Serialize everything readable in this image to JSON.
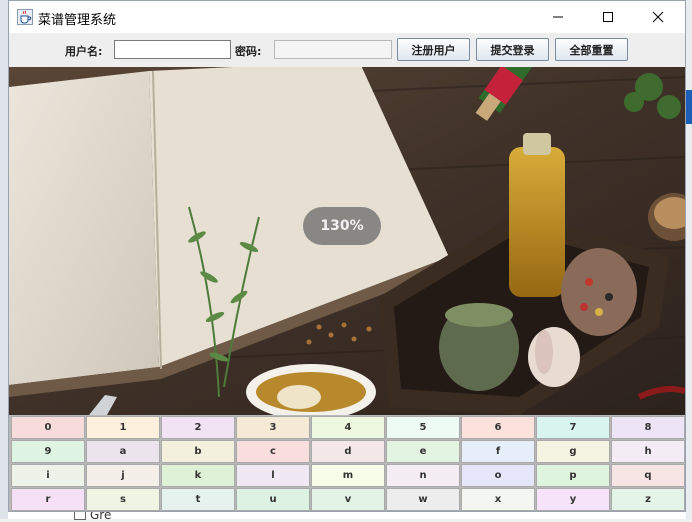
{
  "window": {
    "title": "菜谱管理系统"
  },
  "login": {
    "username_label": "用户名:",
    "username_value": "",
    "password_label": "密码:",
    "password_value": "",
    "register_label": "注册用户",
    "submit_label": "提交登录",
    "reset_label": "全部重置"
  },
  "overlay": {
    "zoom": "130%"
  },
  "keypad": {
    "keys": [
      "0",
      "1",
      "2",
      "3",
      "4",
      "5",
      "6",
      "7",
      "8",
      "9",
      "a",
      "b",
      "c",
      "d",
      "e",
      "f",
      "g",
      "h",
      "i",
      "j",
      "k",
      "l",
      "m",
      "n",
      "o",
      "p",
      "q",
      "r",
      "s",
      "t",
      "u",
      "v",
      "w",
      "x",
      "y",
      "z"
    ],
    "colors": [
      "#f7dcdc",
      "#fdf1dd",
      "#f1e2f4",
      "#f5ead6",
      "#eef8e0",
      "#eefaf4",
      "#fbe2dc",
      "#d9f5ef",
      "#ede4f6",
      "#dff4e2",
      "#ece4ec",
      "#f3f1dd",
      "#f9dede",
      "#f5e8e8",
      "#e3f4e3",
      "#e6eff9",
      "#f4f4e3",
      "#f3ecf4",
      "#eef3ea",
      "#f5efe9",
      "#dff1d7",
      "#f0e8f2",
      "#f6fde9",
      "#f4eef4",
      "#e6e6fb",
      "#dff4df",
      "#f7e4e4",
      "#f6e0f5",
      "#eef6e3",
      "#e5f2ee",
      "#def2e4",
      "#e3f4e6",
      "#ededed",
      "#f3f6f1",
      "#f7e3f9",
      "#e5f4e8"
    ]
  },
  "behind": {
    "fragment": "Gre"
  }
}
